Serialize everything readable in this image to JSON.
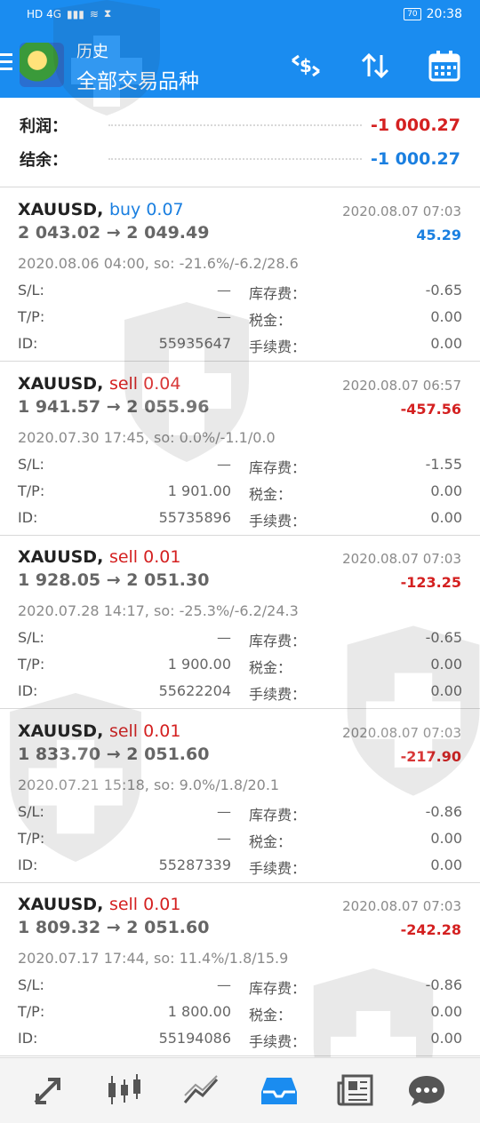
{
  "status_bar": {
    "left_text": "HD 4G",
    "battery": "70",
    "time": "20:38"
  },
  "header": {
    "title": "历史",
    "subtitle": "全部交易品种"
  },
  "summary": {
    "profit_label": "利润：",
    "profit_value": "-1 000.27",
    "balance_label": "结余：",
    "balance_value": "-1 000.27"
  },
  "labels": {
    "sl": "S/L:",
    "tp": "T/P:",
    "id": "ID:",
    "swap": "库存费：",
    "tax": "税金：",
    "fee": "手续费："
  },
  "trades": [
    {
      "symbol": "XAUUSD,",
      "type": "buy 0.07",
      "close_time": "2020.08.07 07:03",
      "prices": "2 043.02 → 2 049.49",
      "profit": "45.29",
      "open_info": "2020.08.06 04:00, so: -21.6%/-6.2/28.6",
      "sl": "—",
      "tp": "—",
      "id": "55935647",
      "swap": "-0.65",
      "tax": "0.00",
      "fee": "0.00"
    },
    {
      "symbol": "XAUUSD,",
      "type": "sell 0.04",
      "close_time": "2020.08.07 06:57",
      "prices": "1 941.57 → 2 055.96",
      "profit": "-457.56",
      "open_info": "2020.07.30 17:45, so: 0.0%/-1.1/0.0",
      "sl": "—",
      "tp": "1 901.00",
      "id": "55735896",
      "swap": "-1.55",
      "tax": "0.00",
      "fee": "0.00"
    },
    {
      "symbol": "XAUUSD,",
      "type": "sell 0.01",
      "close_time": "2020.08.07 07:03",
      "prices": "1 928.05 → 2 051.30",
      "profit": "-123.25",
      "open_info": "2020.07.28 14:17, so: -25.3%/-6.2/24.3",
      "sl": "—",
      "tp": "1 900.00",
      "id": "55622204",
      "swap": "-0.65",
      "tax": "0.00",
      "fee": "0.00"
    },
    {
      "symbol": "XAUUSD,",
      "type": "sell 0.01",
      "close_time": "2020.08.07 07:03",
      "prices": "1 833.70 → 2 051.60",
      "profit": "-217.90",
      "open_info": "2020.07.21 15:18, so: 9.0%/1.8/20.1",
      "sl": "—",
      "tp": "—",
      "id": "55287339",
      "swap": "-0.86",
      "tax": "0.00",
      "fee": "0.00"
    },
    {
      "symbol": "XAUUSD,",
      "type": "sell 0.01",
      "close_time": "2020.08.07 07:03",
      "prices": "1 809.32 → 2 051.60",
      "profit": "-242.28",
      "open_info": "2020.07.17 17:44, so: 11.4%/1.8/15.9",
      "sl": "—",
      "tp": "1 800.00",
      "id": "55194086",
      "swap": "-0.86",
      "tax": "0.00",
      "fee": "0.00"
    }
  ],
  "colors": {
    "accent": "#1a8cf0",
    "buy": "#1a7fe0",
    "sell": "#d42020"
  },
  "nav_icons": [
    "trade-icon",
    "quotes-chart-icon",
    "charts-icon",
    "history-icon",
    "news-icon",
    "chat-icon"
  ]
}
